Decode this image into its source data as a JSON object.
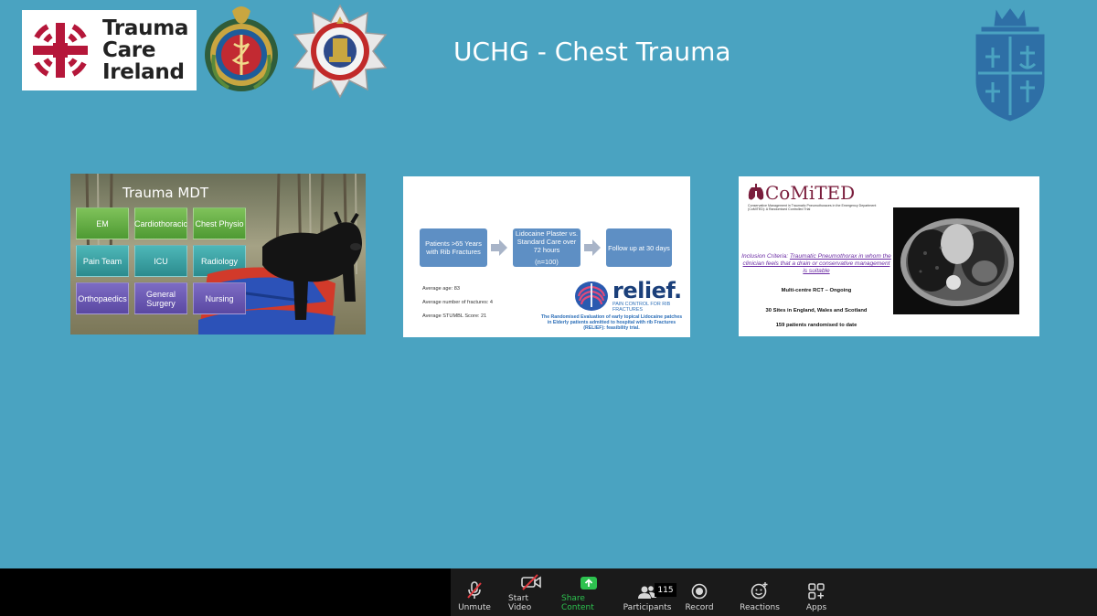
{
  "header": {
    "logo_lines": [
      "Trauma",
      "Care",
      "Ireland"
    ],
    "slide_title": "UCHG - Chest Trauma"
  },
  "thumbnails": {
    "mdt": {
      "title": "Trauma MDT",
      "tiles": [
        {
          "label": "EM",
          "style": "green"
        },
        {
          "label": "Cardiothoracic",
          "style": "green"
        },
        {
          "label": "Chest Physio",
          "style": "green"
        },
        {
          "label": "Pain Team",
          "style": "teal"
        },
        {
          "label": "ICU",
          "style": "teal"
        },
        {
          "label": "Radiology",
          "style": "teal"
        },
        {
          "label": "Orthopaedics",
          "style": "purple"
        },
        {
          "label": "General Surgery",
          "style": "purple"
        },
        {
          "label": "Nursing",
          "style": "purple"
        }
      ]
    },
    "relief": {
      "box1": "Patients >65 Years with Rib Fractures",
      "box2_main": "Lidocaine Plaster vs. Standard Care over 72 hours",
      "box2_sub": "(n=100)",
      "box3": "Follow up at 30 days",
      "stats": [
        "Average age: 83",
        "Average number of fractures: 4",
        "Average STUMBL Score: 21"
      ],
      "logo_word": "relief.",
      "logo_sub": "PAIN CONTROL FOR RIB FRACTURES",
      "description": "The Randomised Evaluation of early topical Lidocaine patches in Elderly patients admitted to hospital with rib Fractures (RELIEF): feasibility trial."
    },
    "comited": {
      "title": "CoMiTED",
      "subtitle": "Conservative Management in Traumatic Pneumothoraces in the Emergency Department (CoMiTED): A Randomised Controlled Trial",
      "inclusion_prefix": "Inclusion Criteria: ",
      "inclusion_text": "Traumatic Pneumothorax in whom the clinician feels that a drain or conservative management is suitable",
      "line1": "Multi-centre RCT – Ongoing",
      "line2": "30 Sites in England, Wales and Scotland",
      "line3": "159 patients randomised to date"
    }
  },
  "toolbar": {
    "unmute": "Unmute",
    "start_video": "Start Video",
    "share_content": "Share Content",
    "participants": "Participants",
    "participants_count": "115",
    "record": "Record",
    "reactions": "Reactions",
    "apps": "Apps"
  },
  "colors": {
    "background": "#4aa3c1",
    "toolbar": "#1a1a1a",
    "share_green": "#2dc24f",
    "logo_red": "#b5173a"
  }
}
